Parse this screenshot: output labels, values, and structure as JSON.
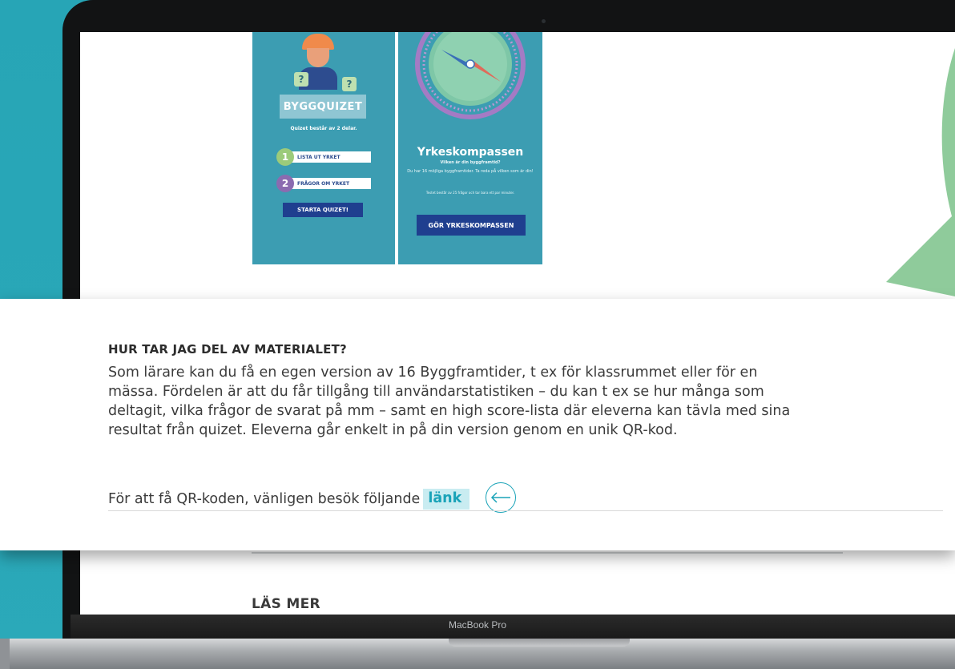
{
  "device": {
    "model_label": "MacBook Pro"
  },
  "bygg_card": {
    "title": "BYGGQUIZET",
    "subtitle": "Quizet består av 2 delar.",
    "steps": [
      {
        "number": "1",
        "label": "LISTA UT YRKET"
      },
      {
        "number": "2",
        "label": "FRÅGOR OM YRKET"
      }
    ],
    "start_button": "STARTA QUIZET!",
    "bubble_symbol": "?"
  },
  "yrkes_card": {
    "title": "Yrkeskompassen",
    "subtitle": "Vilken är din byggframtid?",
    "description": "Du har 16 möjliga byggframtider. Ta reda på vilken som är din!",
    "note": "Testet består av 25 frågor och tar bara ett par minuter.",
    "button": "GÖR YRKESKOMPASSEN"
  },
  "info_panel": {
    "heading": "HUR TAR JAG DEL AV MATERIALET?",
    "lines": [
      "Som lärare kan du få en egen version av 16 Byggframtider, t ex för klassrummet eller för en",
      "mässa. Fördelen är att du får tillgång till användarstatistiken – du kan t ex se hur många som",
      "deltagit, vilka frågor de svarat på mm – samt en high score-lista där eleverna kan tävla med sina",
      "resultat från quizet. Eleverna går enkelt in på din version genom en unik QR-kod."
    ],
    "link_prefix": "För att få QR-koden, vänligen besök följande",
    "link_text": "länk"
  },
  "section": {
    "read_more": "LÄS MER"
  },
  "colors": {
    "background": "#2aa7b7",
    "card": "#3c9db2",
    "button_navy": "#1f3f8f",
    "link_accent": "#1aa3b8",
    "green_accent": "#8fcb9b"
  }
}
